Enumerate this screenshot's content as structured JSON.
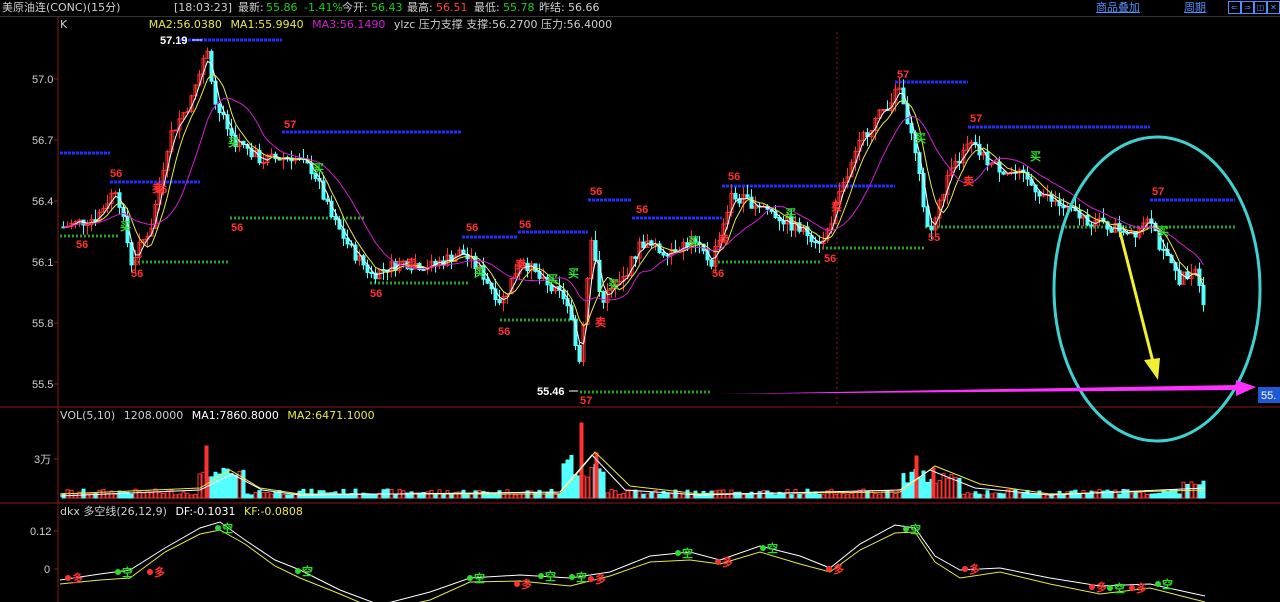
{
  "topbar": {
    "title": "美原油连(CONC)(15分)",
    "time": "[18:03:23]",
    "latest_label": "最新:",
    "latest_value": "55.86",
    "change": "-1.41%",
    "open_label": "今开:",
    "open_value": "56.43",
    "high_label": "最高:",
    "high_value": "56.51",
    "low_label": "最低:",
    "low_value": "55.78",
    "prev_label": "昨结:",
    "prev_value": "56.66",
    "overlay_link": "商品叠加",
    "period_link": "周期"
  },
  "main_panel": {
    "k_label": "K",
    "ma2": "MA2:56.0380",
    "ma1": "MA1:55.9940",
    "ma3": "MA3:56.1490",
    "indicator": "ylzc 压力支撑 支撑:56.2700 压力:56.4000",
    "y_ticks": [
      "57.0",
      "56.7",
      "56.4",
      "56.1",
      "55.8",
      "55.5"
    ],
    "high_marker": "57.19",
    "low_marker": "55.46",
    "price_tag": "55.",
    "level_labels": [
      "57",
      "57",
      "57",
      "56",
      "56",
      "56",
      "56",
      "56",
      "56",
      "56",
      "56",
      "56",
      "56",
      "56",
      "56",
      "56",
      "56",
      "55"
    ],
    "signals": [
      "买",
      "卖"
    ]
  },
  "volume_panel": {
    "label": "VOL(5,10)",
    "value": "1208.0000",
    "ma1": "MA1:7860.8000",
    "ma2": "MA2:6471.1000",
    "y_tick": "3万"
  },
  "dkx_panel": {
    "label": "dkx 多空线(26,12,9)",
    "df": "DF:-0.1031",
    "kf": "KF:-0.0808",
    "y_ticks": [
      "0.12",
      "0"
    ],
    "signals": [
      "空",
      "多"
    ]
  },
  "colors": {
    "up": "#ff3232",
    "down": "#54ffff",
    "ma1": "#ffffff",
    "ma2": "#e8e84a",
    "ma3": "#d020d0",
    "resistance": "#2030ff",
    "support": "#28a028",
    "circle": "#40d0d0",
    "arrow_yellow": "#f0f030",
    "arrow_magenta": "#ff30ff"
  }
}
